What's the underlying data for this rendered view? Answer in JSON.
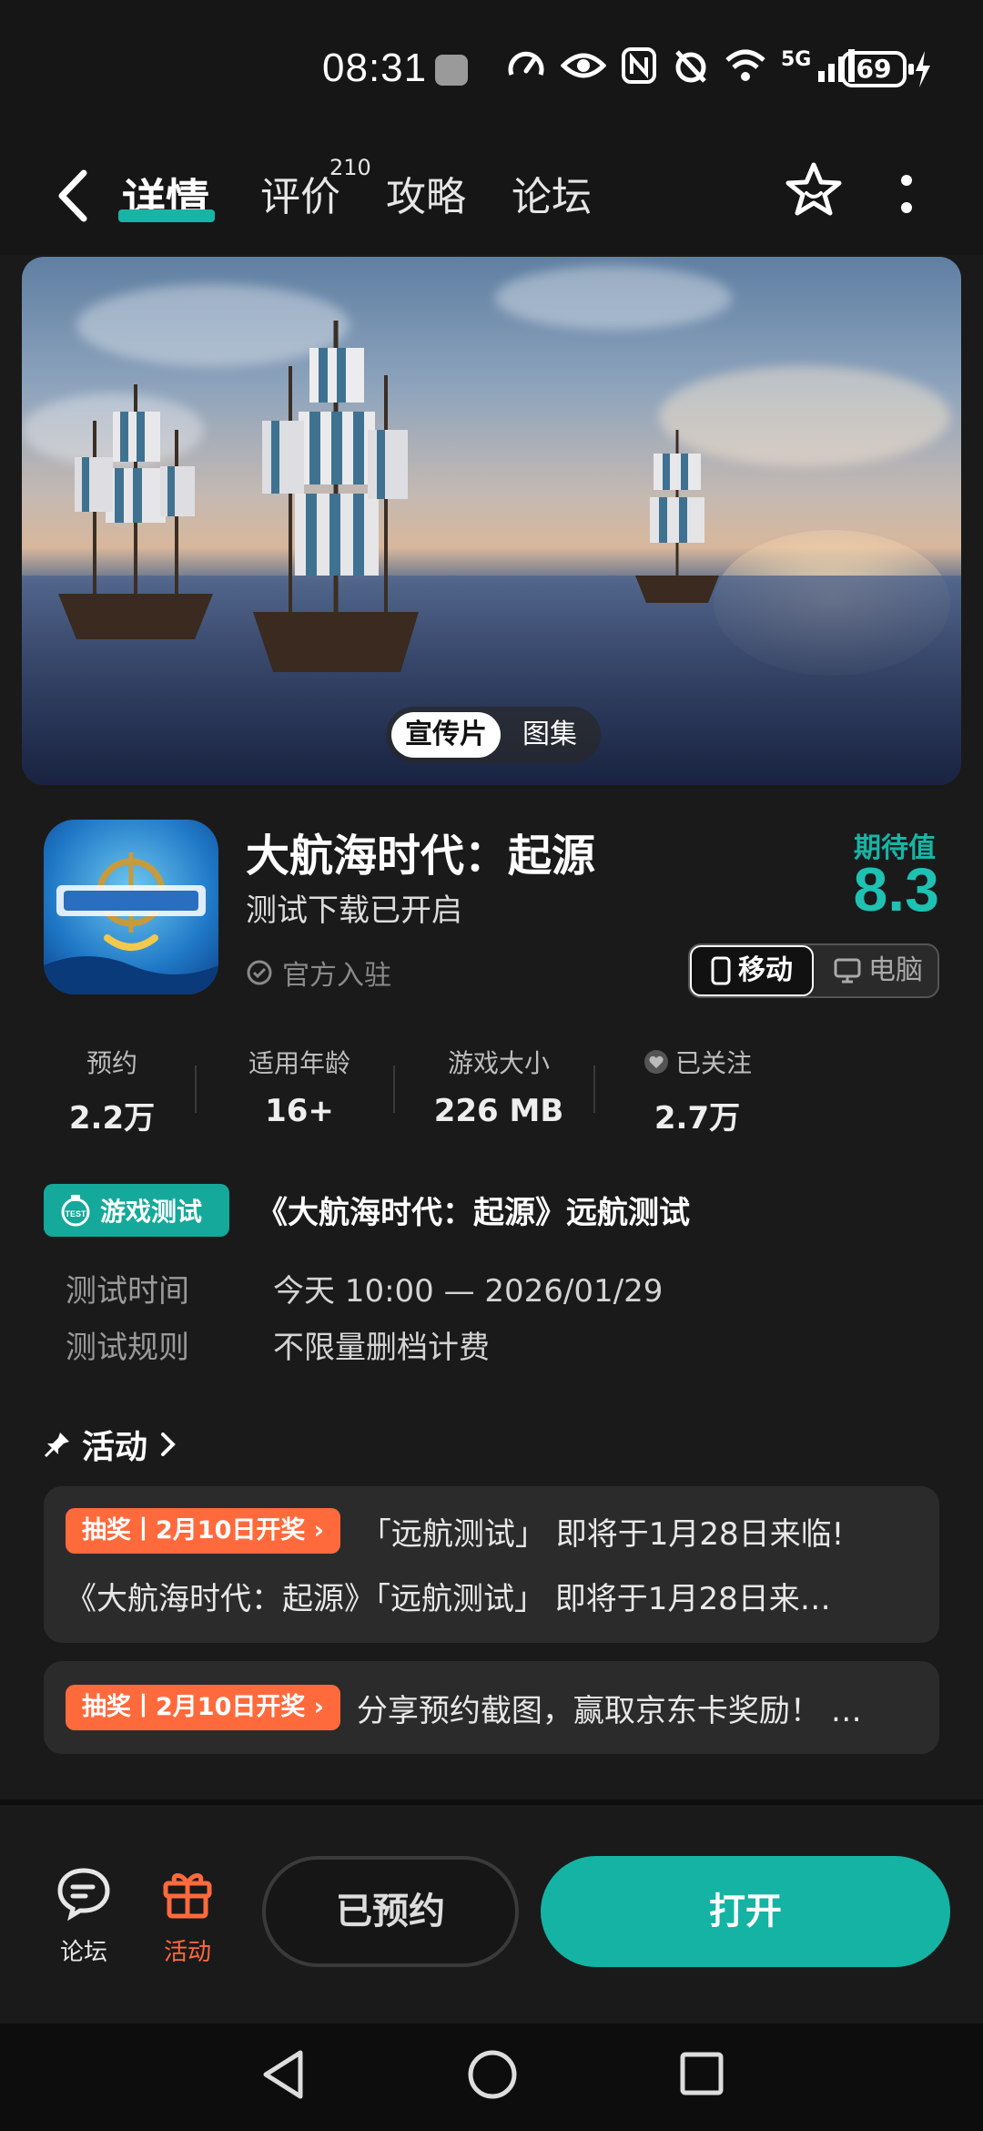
{
  "status_bar": {
    "time": "08:31",
    "network": "5G",
    "battery": "69"
  },
  "nav": {
    "tabs": [
      {
        "label": "详情"
      },
      {
        "label": "评价",
        "badge": "210"
      },
      {
        "label": "攻略"
      },
      {
        "label": "论坛"
      }
    ],
    "icons": [
      "back-arrow-icon",
      "star-icon",
      "more-icon"
    ]
  },
  "hero": {
    "toggle": [
      "宣传片",
      "图集"
    ]
  },
  "app": {
    "title": "大航海时代：起源",
    "subtitle": "测试下载已开启",
    "official": "官方入驻",
    "score_label": "期待值",
    "score": "8.3",
    "platforms": [
      "移动",
      "电脑"
    ]
  },
  "stats": [
    {
      "label": "预约",
      "value": "2.2万"
    },
    {
      "label": "适用年龄",
      "value": "16+"
    },
    {
      "label": "游戏大小",
      "value": "226 MB"
    },
    {
      "label": "已关注",
      "value": "2.7万"
    }
  ],
  "test": {
    "badge": "游戏测试",
    "title": "《大航海时代：起源》远航测试",
    "rows": [
      {
        "label": "测试时间",
        "value": "今天 10:00 — 2026/01/29"
      },
      {
        "label": "测试规则",
        "value": "不限量删档计费"
      }
    ]
  },
  "activities": {
    "heading": "活动",
    "items": [
      {
        "tag": "抽奖丨2月10日开奖",
        "line1": "「远航测试」 即将于1月28日来临!",
        "line2": "《大航海时代：起源》「远航测试」 即将于1月28日来…"
      },
      {
        "tag": "抽奖丨2月10日开奖",
        "line1": "分享预约截图，赢取京东卡奖励！ …"
      }
    ]
  },
  "bottom": {
    "forum": "论坛",
    "activity": "活动",
    "reserved": "已预约",
    "open": "打开"
  },
  "colors": {
    "accent": "#18b4a6",
    "orange": "#ff6a3d",
    "bg": "#1a1a1a"
  }
}
